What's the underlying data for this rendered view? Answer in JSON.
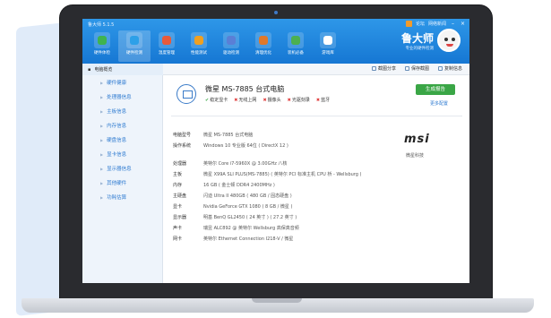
{
  "app": {
    "title": "鲁大师 5.1.5",
    "window_links": [
      "论坛",
      "网络新闻"
    ],
    "minimize": "–",
    "close": "×"
  },
  "toolbar": {
    "items": [
      {
        "label": "硬件体检",
        "icon": "shield-icon",
        "color": "#3fb34f"
      },
      {
        "label": "硬件检测",
        "icon": "chip-icon",
        "color": "#2da0e8"
      },
      {
        "label": "温度管理",
        "icon": "chart-icon",
        "color": "#e85a3a"
      },
      {
        "label": "性能测试",
        "icon": "gauge-icon",
        "color": "#f0a020"
      },
      {
        "label": "驱动检测",
        "icon": "gear-icon",
        "color": "#5a7fd6"
      },
      {
        "label": "清理优化",
        "icon": "broom-icon",
        "color": "#e0782a"
      },
      {
        "label": "装机必备",
        "icon": "boxes-icon",
        "color": "#4cb050"
      },
      {
        "label": "游戏库",
        "icon": "gamepad-icon",
        "color": "#ffffff"
      }
    ],
    "active_index": 1
  },
  "brand": {
    "name": "鲁大师",
    "sub": "专业的硬件检测"
  },
  "subbar": {
    "section": "电脑概览",
    "actions": [
      "截图分享",
      "保存截图",
      "复制信息"
    ]
  },
  "sidebar": {
    "items": [
      "硬件健康",
      "处理器信息",
      "主板信息",
      "内存信息",
      "硬盘信息",
      "显卡信息",
      "显示器信息",
      "其他硬件",
      "功耗估算"
    ]
  },
  "summary": {
    "title": "微星 MS-7885 台式电脑",
    "checks": [
      {
        "mark": "ok",
        "label": "稳定显卡"
      },
      {
        "mark": "x",
        "label": "无线上网"
      },
      {
        "mark": "x",
        "label": "摄像头"
      },
      {
        "mark": "x",
        "label": "光驱刻录"
      },
      {
        "mark": "x",
        "label": "蓝牙"
      }
    ],
    "print_button": "生成报告",
    "more_link": "更多配置"
  },
  "specs": [
    {
      "k": "电脑型号",
      "v": "微星 MS-7885 台式电脑"
    },
    {
      "k": "操作系统",
      "v": "Windows 10 专业版 64位 ( DirectX 12 )"
    },
    {
      "k": "处理器",
      "v": "英特尔 Core i7-5960X @ 3.00GHz 八核",
      "gap": true
    },
    {
      "k": "主板",
      "v": "微星 X99A SLI PLUS(MS-7885) ( 英特尔 PCI 标准主机 CPU 桥 - Wellsburg )"
    },
    {
      "k": "内存",
      "v": "16 GB ( 金士顿 DDR4 2400MHz )"
    },
    {
      "k": "主硬盘",
      "v": "闪迪 Ultra II 480GB ( 480 GB / 固态硬盘 )"
    },
    {
      "k": "显卡",
      "v": "Nvidia GeForce GTX 1080 ( 8 GB / 微星 )"
    },
    {
      "k": "显示器",
      "v": "明基 BenQ GL2450 ( 24 英寸 ) ( 27.2 英寸 )"
    },
    {
      "k": "声卡",
      "v": "瑞昱 ALC892 @ 英特尔 Wellsburg 高保真音频"
    },
    {
      "k": "网卡",
      "v": "英特尔 Ethernet Connection I218-V / 微星"
    }
  ],
  "vendor": {
    "logo_text": "msi",
    "caption": "微星科技"
  }
}
